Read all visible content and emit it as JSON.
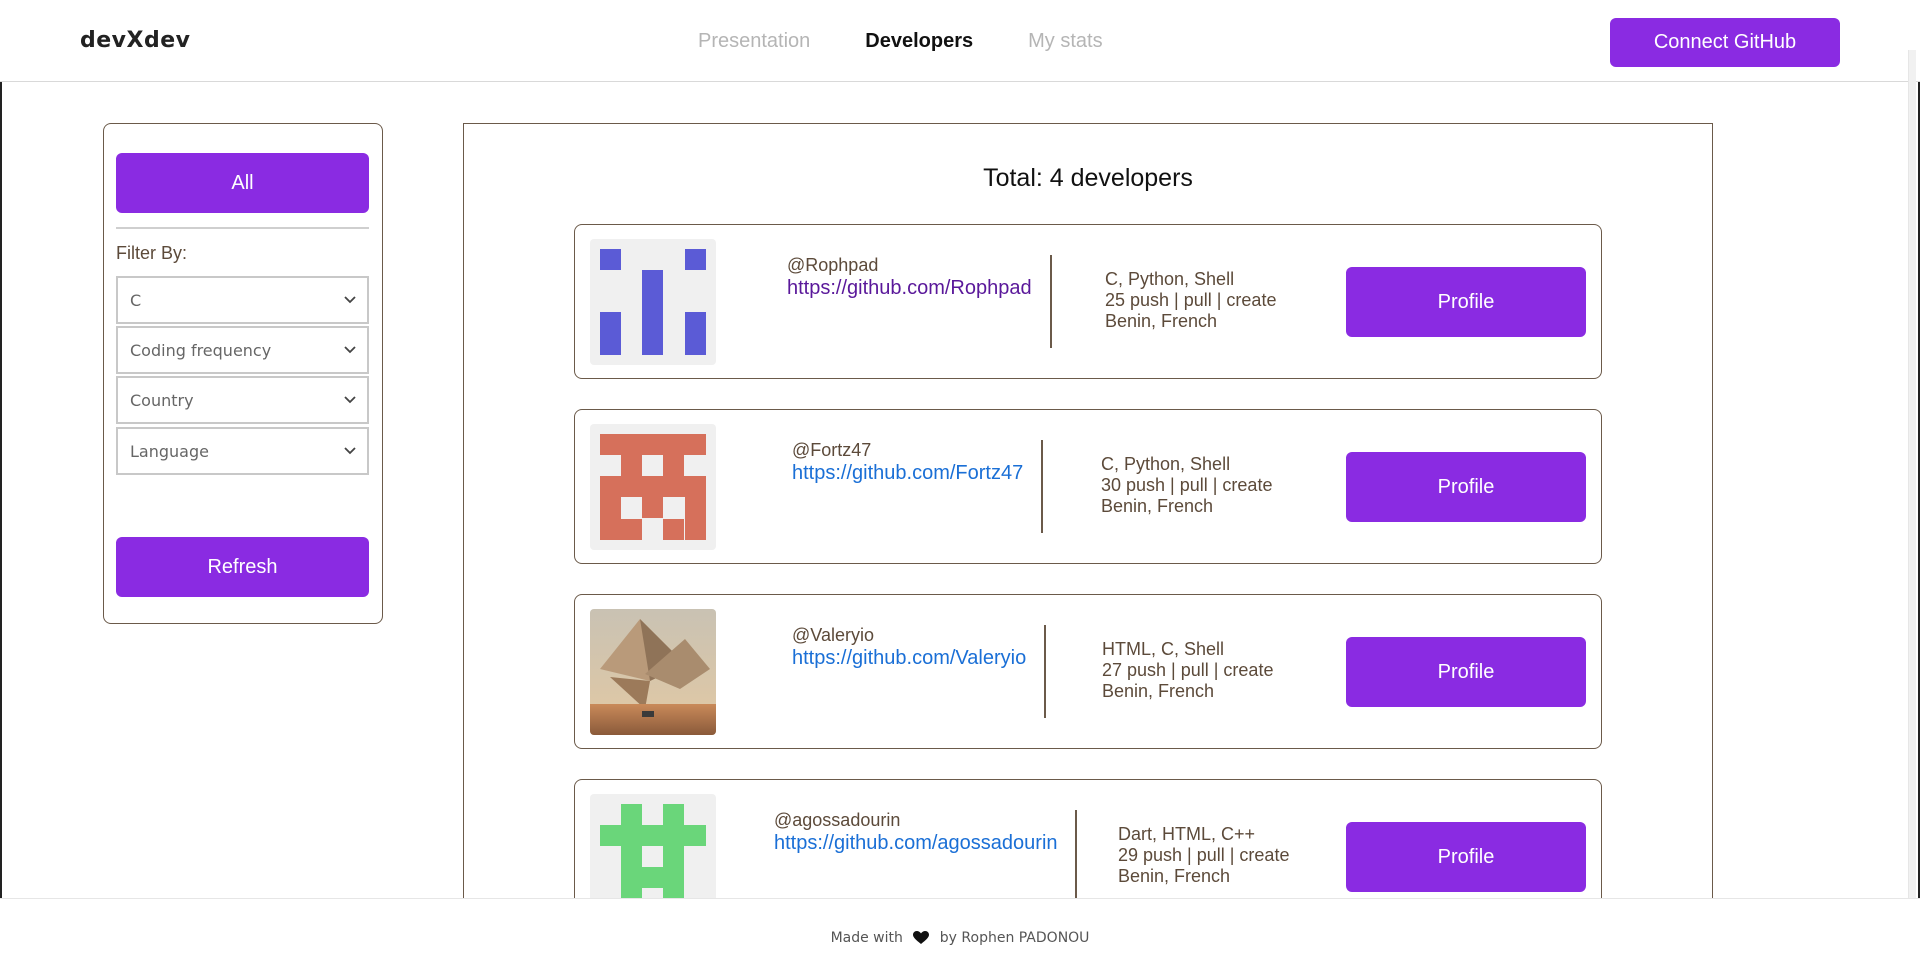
{
  "header": {
    "brand": "devXdev",
    "nav": [
      {
        "label": "Presentation",
        "active": false
      },
      {
        "label": "Developers",
        "active": true
      },
      {
        "label": "My stats",
        "active": false
      }
    ],
    "connect_label": "Connect GitHub"
  },
  "sidebar": {
    "all_label": "All",
    "filter_label": "Filter By:",
    "selects": [
      {
        "value": "C"
      },
      {
        "value": "Coding frequency"
      },
      {
        "value": "Country"
      },
      {
        "value": "Language"
      }
    ],
    "refresh_label": "Refresh"
  },
  "main": {
    "total": "Total: 4 developers",
    "developers": [
      {
        "handle": "@Rophpad",
        "url": "https://github.com/Rophpad",
        "languages": "C, Python, Shell",
        "activity": "25 push | pull | create",
        "location": "Benin, French",
        "profile_label": "Profile",
        "avatar": "identicon-blue"
      },
      {
        "handle": "@Fortz47",
        "url": "https://github.com/Fortz47",
        "languages": "C, Python, Shell",
        "activity": "30 push | pull | create",
        "location": "Benin, French",
        "profile_label": "Profile",
        "avatar": "identicon-salmon"
      },
      {
        "handle": "@Valeryio",
        "url": "https://github.com/Valeryio",
        "languages": "HTML, C, Shell",
        "activity": "27 push | pull | create",
        "location": "Benin, French",
        "profile_label": "Profile",
        "avatar": "photo-pyramids"
      },
      {
        "handle": "@agossadourin",
        "url": "https://github.com/agossadourin",
        "languages": "Dart, HTML, C++",
        "activity": "29 push | pull | create",
        "location": "Benin, French",
        "profile_label": "Profile",
        "avatar": "identicon-green"
      }
    ]
  },
  "footer": {
    "made_with": "Made with",
    "by": "by Rophen PADONOU"
  },
  "colors": {
    "accent": "#8a2be2",
    "link": "#1a6fd6",
    "visited_link": "#5a189a",
    "muted_text": "#5c4a3a"
  }
}
